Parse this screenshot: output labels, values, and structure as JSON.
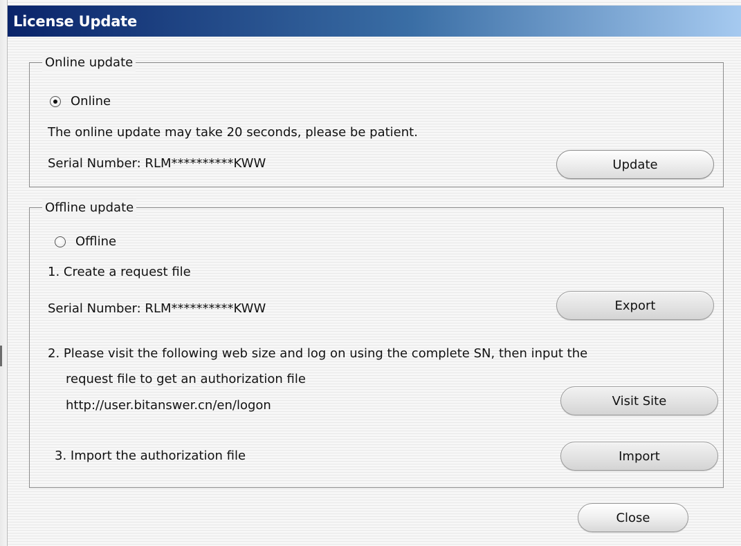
{
  "window": {
    "title": "License Update"
  },
  "online": {
    "legend": "Online update",
    "radio_label": "Online",
    "radio_checked": true,
    "note": "The online update  may take 20 seconds, please be patient.",
    "serial": "Serial Number: RLM**********KWW",
    "update_label": "Update"
  },
  "offline": {
    "legend": "Offline update",
    "radio_label": "Offline",
    "radio_checked": false,
    "step1": "1. Create a request file",
    "serial": "Serial Number: RLM**********KWW",
    "export_label": "Export",
    "step2_line1": "2. Please visit the following web size and log on using the complete SN, then input the",
    "step2_line2": "request file to get an authorization file",
    "step2_url": "http://user.bitanswer.cn/en/logon",
    "visit_label": "Visit Site",
    "step3": "3. Import the authorization file",
    "import_label": "Import"
  },
  "footer": {
    "close_label": "Close"
  },
  "colors": {
    "titlebar_start": "#0a246a",
    "titlebar_end": "#a6caf0",
    "title_text": "#ffffff"
  }
}
